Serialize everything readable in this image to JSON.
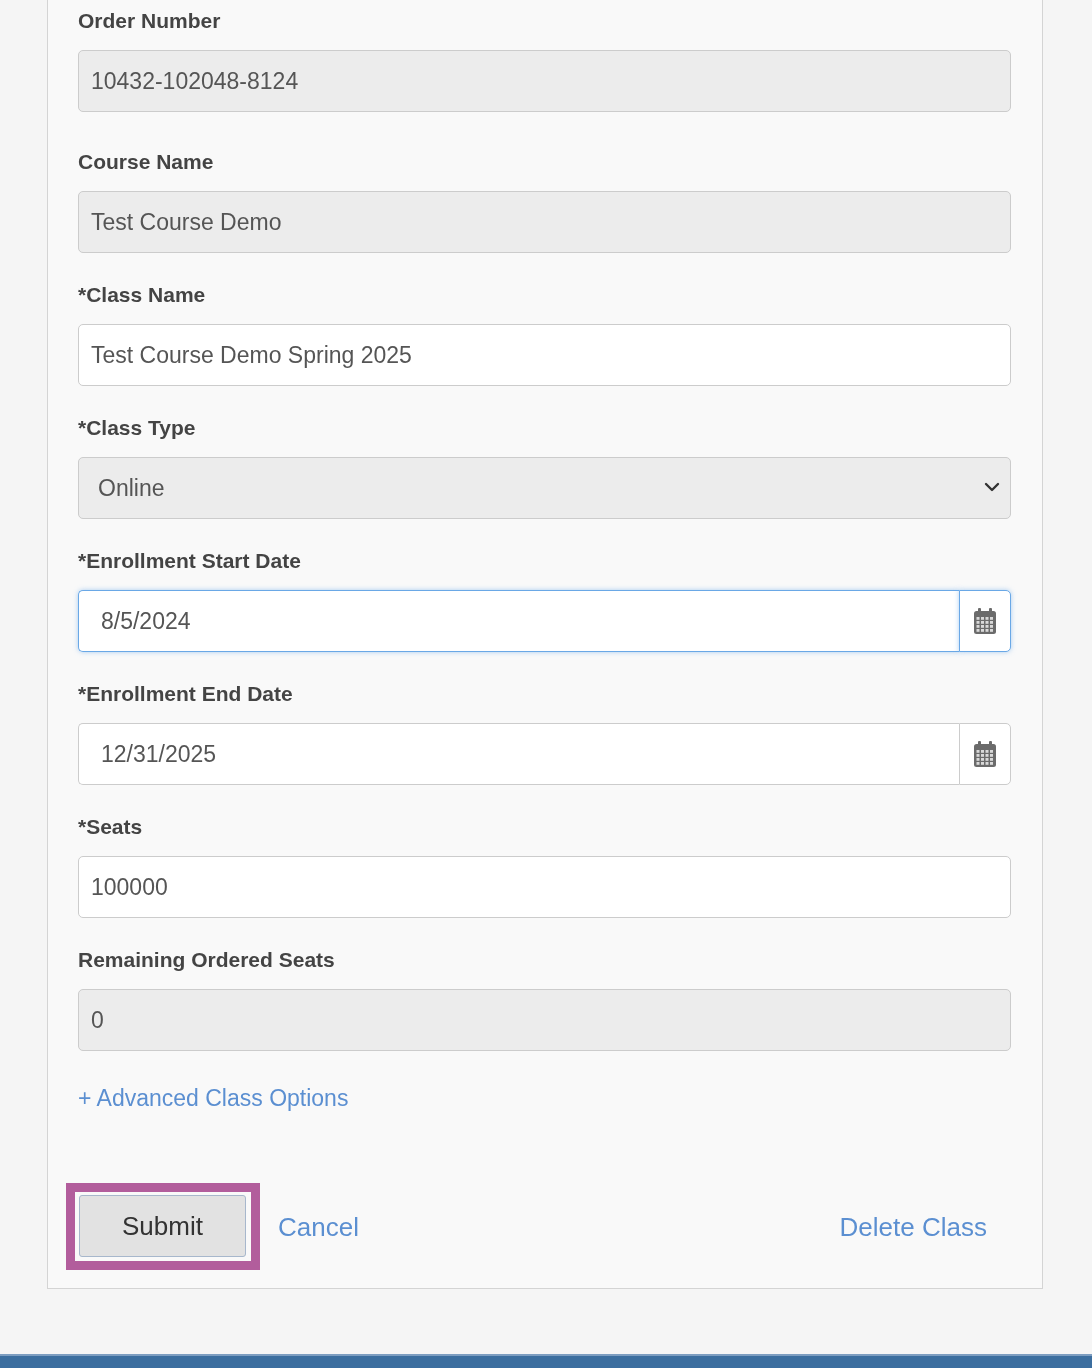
{
  "form": {
    "fields": [
      {
        "kind": "text",
        "label": "Order Number",
        "value": "10432-102048-8124",
        "disabled": true,
        "focused": false
      },
      {
        "kind": "text",
        "label": "Course Name",
        "value": "Test Course Demo",
        "disabled": true,
        "focused": false
      },
      {
        "kind": "text",
        "label": "*Class Name",
        "value": "Test Course Demo Spring 2025",
        "disabled": false,
        "focused": false
      },
      {
        "kind": "select",
        "label": "*Class Type",
        "value": "Online",
        "disabled": true,
        "focused": false
      },
      {
        "kind": "date",
        "label": "*Enrollment Start Date",
        "value": "8/5/2024",
        "disabled": false,
        "focused": true
      },
      {
        "kind": "date",
        "label": "*Enrollment End Date",
        "value": "12/31/2025",
        "disabled": false,
        "focused": false
      },
      {
        "kind": "text",
        "label": "*Seats",
        "value": "100000",
        "disabled": false,
        "focused": false
      },
      {
        "kind": "text",
        "label": "Remaining Ordered Seats",
        "value": "0",
        "disabled": true,
        "focused": false
      }
    ],
    "advanced_link": "+ Advanced Class Options",
    "actions": [
      {
        "kind": "button",
        "label": "Submit",
        "highlighted": true
      },
      {
        "kind": "link",
        "label": "Cancel",
        "highlighted": false
      },
      {
        "kind": "link",
        "label": "Delete Class",
        "highlighted": false
      }
    ]
  }
}
